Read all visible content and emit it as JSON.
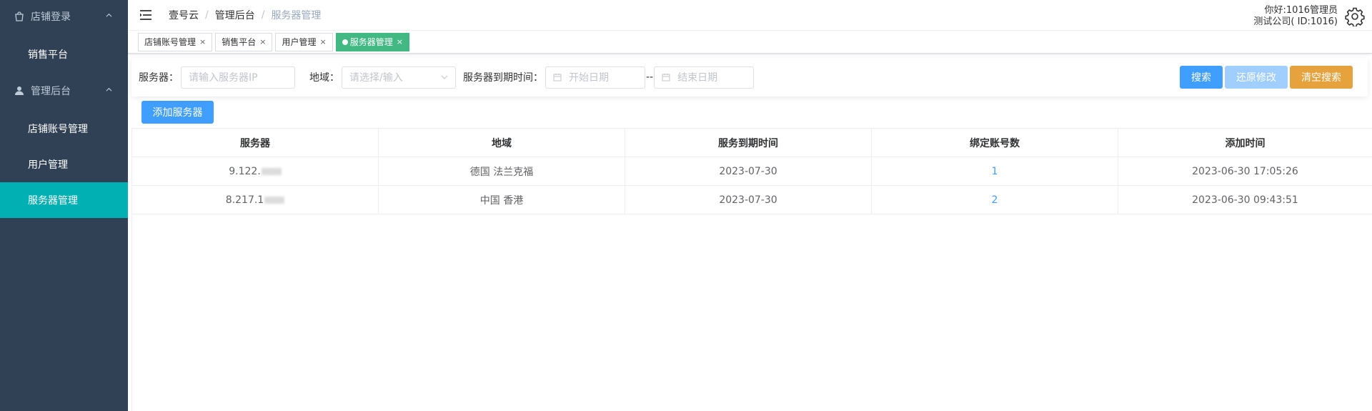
{
  "sidebar": {
    "group1": {
      "label": "店铺登录",
      "icon": "bag-icon"
    },
    "group1_items": [
      {
        "label": "销售平台"
      }
    ],
    "group2": {
      "label": "管理后台",
      "icon": "user-icon"
    },
    "group2_items": [
      {
        "label": "店铺账号管理"
      },
      {
        "label": "用户管理"
      },
      {
        "label": "服务器管理"
      }
    ],
    "colors": {
      "background": "#304156",
      "active": "#00b0b3"
    }
  },
  "navbar": {
    "breadcrumb": [
      "壹号云",
      "管理后台",
      "服务器管理"
    ],
    "separator": "/",
    "greeting": "你好:1016管理员",
    "company": "测试公司( ID:1016)"
  },
  "tags": [
    {
      "label": "店铺账号管理",
      "close": "×"
    },
    {
      "label": "销售平台",
      "close": "×"
    },
    {
      "label": "用户管理",
      "close": "×"
    },
    {
      "label": "服务器管理",
      "close": "×",
      "active": true
    }
  ],
  "search": {
    "server_label": "服务器：",
    "server_placeholder": "请输入服务器IP",
    "region_label": "地域：",
    "region_placeholder": "请选择/输入",
    "expire_label": "服务器到期时间：",
    "start_placeholder": "开始日期",
    "range_sep": "--",
    "end_placeholder": "结束日期",
    "search_btn": "搜索",
    "restore_btn": "还原修改",
    "clear_btn": "清空搜索"
  },
  "add_button": "添加服务器",
  "table": {
    "headers": [
      "服务器",
      "地域",
      "服务到期时间",
      "绑定账号数",
      "添加时间"
    ],
    "rows": [
      {
        "server": "9.122.",
        "region": "德国 法兰克福",
        "expire": "2023-07-30",
        "accounts": "1",
        "added": "2023-06-30 17:05:26"
      },
      {
        "server": "8.217.1",
        "region": "中国 香港",
        "expire": "2023-07-30",
        "accounts": "2",
        "added": "2023-06-30 09:43:51"
      }
    ]
  },
  "colors": {
    "primary": "#409eff",
    "warning": "#e6a23c",
    "tag_active": "#42b983"
  }
}
